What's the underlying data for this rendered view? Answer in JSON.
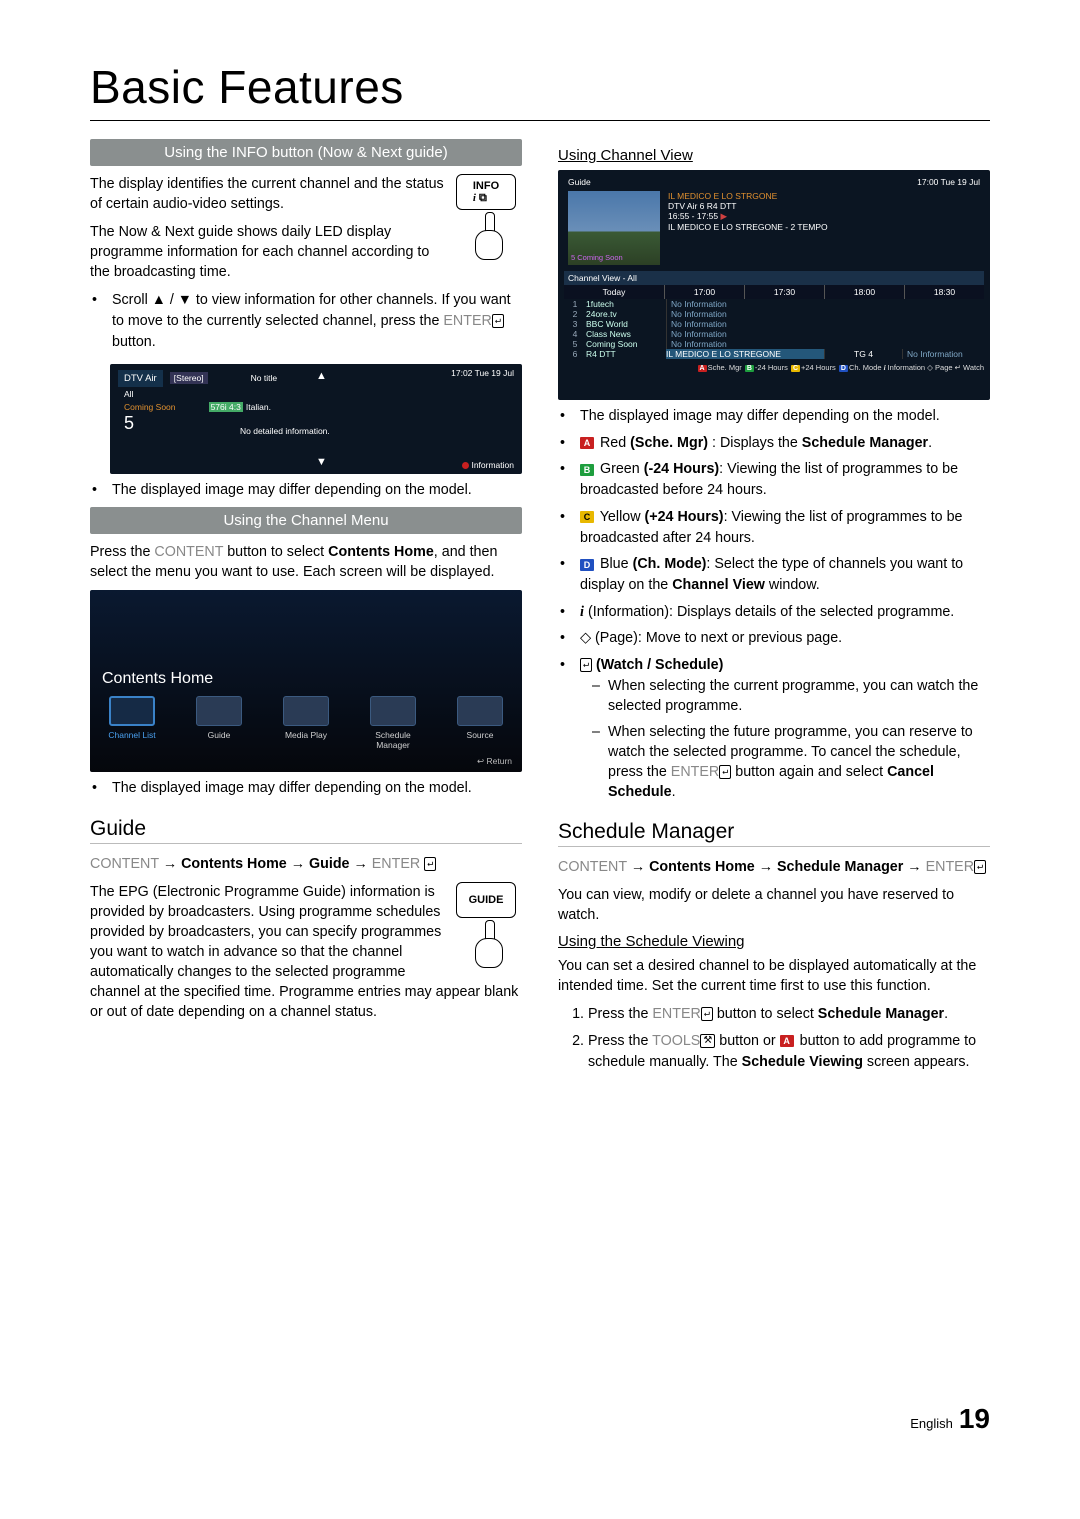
{
  "page": {
    "title": "Basic Features",
    "footer_lang": "English",
    "footer_page": "19"
  },
  "left": {
    "sec1": {
      "bar": "Using the INFO button (Now & Next guide)",
      "key_label": "INFO",
      "p1": "The display identifies the current channel and the status of certain audio-video settings.",
      "p2": "The Now & Next guide shows daily LED display programme information for each channel according to the broadcasting time.",
      "bullet_pre": "Scroll ",
      "bullet_icons": "▲ / ▼",
      "bullet_post": " to view information for other channels. If you want to move to the currently selected channel, press the ",
      "bullet_enter": "ENTER",
      "bullet_end": " button.",
      "shot": {
        "time": "17:02 Tue 19 Jul",
        "hdr_air": "DTV Air",
        "hdr_stereo": "[Stereo]",
        "hdr_all": "All",
        "hdr_cs": "Coming Soon",
        "hdr_num": "5",
        "no_title": "No title",
        "badges": "576i  4:3",
        "extra": "Italian.",
        "detail": "No detailed information.",
        "info": "Information"
      },
      "note": "The displayed image may differ depending on the model."
    },
    "sec2": {
      "bar": "Using the Channel Menu",
      "p_pre": "Press the ",
      "p_btn": "CONTENT",
      "p_mid": " button to select ",
      "p_bold": "Contents Home",
      "p_end": ", and then select the menu you want to use. Each screen will be displayed.",
      "shot": {
        "title": "Contents Home",
        "items": [
          "Channel List",
          "Guide",
          "Media Play",
          "Schedule Manager",
          "Source"
        ],
        "return": "↩ Return"
      },
      "note": "The displayed image may differ depending on the model."
    },
    "guide": {
      "h3": "Guide",
      "nav_seq": [
        "CONTENT",
        " → ",
        "Contents Home",
        " → ",
        "Guide",
        " → ",
        "ENTER"
      ],
      "key_label": "GUIDE",
      "p": "The EPG (Electronic Programme Guide) information is provided by broadcasters. Using programme schedules provided by broadcasters, you can specify programmes you want to watch in advance so that the channel automatically changes to the selected programme channel at the specified time. Programme entries may appear blank or out of date depending on a channel status."
    }
  },
  "right": {
    "cv": {
      "h4": "Using Channel View",
      "shot": {
        "time": "17:00 Tue 19 Jul",
        "guide_label": "Guide",
        "prog_title": "IL MEDICO E LO STRGONE",
        "prog_sub": "DTV Air 6 R4 DTT",
        "prog_time": "16:55 - 17:55",
        "prog_ep": "IL MEDICO E LO STREGONE  - 2 TEMPO",
        "coming": "5 Coming Soon",
        "view_all": "Channel View - All",
        "cols": [
          "Today",
          "17:00",
          "17:30",
          "18:00",
          "18:30"
        ],
        "rows": [
          {
            "n": "1",
            "name": "1futech",
            "info": "No Information"
          },
          {
            "n": "2",
            "name": "24ore.tv",
            "info": "No Information"
          },
          {
            "n": "3",
            "name": "BBC World",
            "info": "No Information"
          },
          {
            "n": "4",
            "name": "Class News",
            "info": "No Information"
          },
          {
            "n": "5",
            "name": "Coming Soon",
            "info": "No Information"
          },
          {
            "n": "6",
            "name": "R4 DTT",
            "sel": "IL MEDICO E LO STREGONE",
            "mid": "TG 4",
            "info": "No Information"
          }
        ],
        "legend": [
          "Sche. Mgr",
          "-24 Hours",
          "+24 Hours",
          "Ch. Mode",
          "Information",
          "Page",
          "Watch"
        ]
      },
      "note": "The displayed image may differ depending on the model.",
      "bullets": [
        {
          "tag": "A",
          "clr": "#c82020",
          "label": " Red ",
          "bold": "(Sche. Mgr)",
          "post": " : Displays the ",
          "bold2": "Schedule Manager",
          "post2": "."
        },
        {
          "tag": "B",
          "clr": "#1e9e3e",
          "label": " Green ",
          "bold": "(-24 Hours)",
          "post": ": Viewing the list of programmes to be broadcasted before 24 hours."
        },
        {
          "tag": "C",
          "clr": "#e8b800",
          "label": " Yellow ",
          "bold": "(+24 Hours)",
          "post": ": Viewing the list of programmes to be broadcasted after 24 hours."
        },
        {
          "tag": "D",
          "clr": "#2050c0",
          "label": " Blue ",
          "bold": "(Ch. Mode)",
          "post": ": Select the type of channels you want to display on the ",
          "bold2": "Channel View",
          "post2": " window."
        },
        {
          "icon": "i",
          "label": " (Information)",
          "post": ": Displays details of the selected programme."
        },
        {
          "icon": "page",
          "label": " (Page)",
          "post": ": Move to next or previous page."
        },
        {
          "icon": "enter",
          "label": " (Watch / Schedule)"
        }
      ],
      "dashes": [
        "When selecting the current programme, you can watch the selected programme.",
        ""
      ],
      "dash2_pre": "When selecting the future programme, you can reserve to watch the selected programme. To cancel the schedule, press the ",
      "dash2_enter": "ENTER",
      "dash2_mid": " button again and select ",
      "dash2_bold": "Cancel Schedule",
      "dash2_end": "."
    },
    "sm": {
      "h3": "Schedule Manager",
      "nav_seq": [
        "CONTENT",
        " → ",
        "Contents Home",
        " → ",
        "Schedule Manager",
        " → ",
        "ENTER"
      ],
      "p": "You can view, modify or delete a channel you have reserved to watch.",
      "h4": "Using the Schedule Viewing",
      "p2": "You can set a desired channel to be displayed automatically at the intended time. Set the current time first to use this function.",
      "step1_pre": "Press the ",
      "step1_enter": "ENTER",
      "step1_mid": " button to select ",
      "step1_bold": "Schedule Manager",
      "step1_end": ".",
      "step2_pre": "Press the ",
      "step2_tools": "TOOLS",
      "step2_mid1": " button or ",
      "step2_mid2": " button to add programme to schedule manually. The ",
      "step2_bold": "Schedule Viewing",
      "step2_end": " screen appears."
    }
  }
}
